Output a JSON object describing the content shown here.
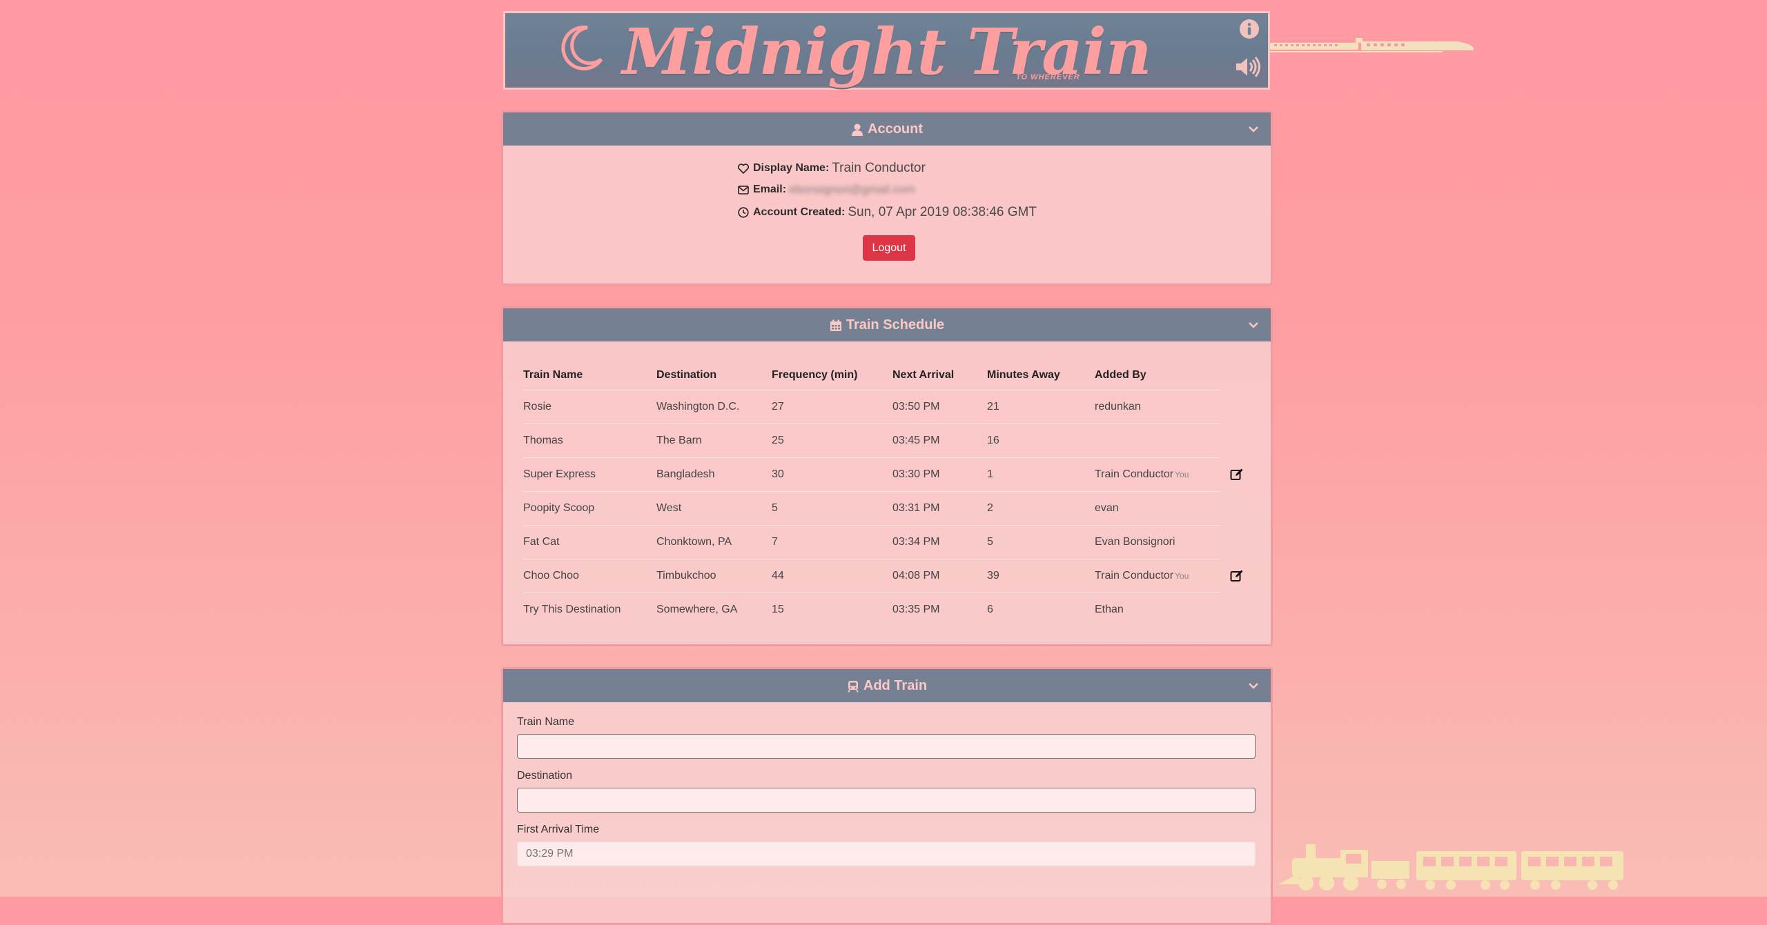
{
  "header": {
    "title": "Midnight Train",
    "subtitle": "TO WHEREVER",
    "icons": [
      "moon-icon",
      "info-icon",
      "volume-icon"
    ]
  },
  "account": {
    "title": "Account",
    "display_name_label": "Display Name:",
    "display_name": "Train Conductor",
    "email_label": "Email:",
    "email": "ebonsignori@gmail.com",
    "created_label": "Account Created:",
    "created": "Sun, 07 Apr 2019 08:38:46 GMT",
    "logout_label": "Logout"
  },
  "schedule": {
    "title": "Train Schedule",
    "columns": [
      "Train Name",
      "Destination",
      "Frequency (min)",
      "Next Arrival",
      "Minutes Away",
      "Added By"
    ],
    "rows": [
      {
        "name": "Rosie",
        "destination": "Washington D.C.",
        "frequency": "27",
        "next": "03:50 PM",
        "away": "21",
        "added_by": "redunkan",
        "you": "",
        "editable": false
      },
      {
        "name": "Thomas",
        "destination": "The Barn",
        "frequency": "25",
        "next": "03:45 PM",
        "away": "16",
        "added_by": "",
        "you": "",
        "editable": false
      },
      {
        "name": "Super Express",
        "destination": "Bangladesh",
        "frequency": "30",
        "next": "03:30 PM",
        "away": "1",
        "added_by": "Train Conductor",
        "you": "You",
        "editable": true
      },
      {
        "name": "Poopity Scoop",
        "destination": "West",
        "frequency": "5",
        "next": "03:31 PM",
        "away": "2",
        "added_by": "evan",
        "you": "",
        "editable": false
      },
      {
        "name": "Fat Cat",
        "destination": "Chonktown, PA",
        "frequency": "7",
        "next": "03:34 PM",
        "away": "5",
        "added_by": "Evan Bonsignori",
        "you": "",
        "editable": false
      },
      {
        "name": "Choo Choo",
        "destination": "Timbukchoo",
        "frequency": "44",
        "next": "04:08 PM",
        "away": "39",
        "added_by": "Train Conductor",
        "you": "You",
        "editable": true
      },
      {
        "name": "Try This Destination",
        "destination": "Somewhere, GA",
        "frequency": "15",
        "next": "03:35 PM",
        "away": "6",
        "added_by": "Ethan",
        "you": "",
        "editable": false
      }
    ]
  },
  "add_train": {
    "title": "Add Train",
    "train_name_label": "Train Name",
    "train_name_value": "",
    "destination_label": "Destination",
    "destination_value": "",
    "first_arrival_label": "First Arrival Time",
    "first_arrival_placeholder": "03:29 PM"
  },
  "colors": {
    "background": "#fe9ea2",
    "panel_header": "#758193",
    "title_pink": "#fd9e9f",
    "logout_red": "#dc3545",
    "train_yellow": "#f6e3b4"
  }
}
